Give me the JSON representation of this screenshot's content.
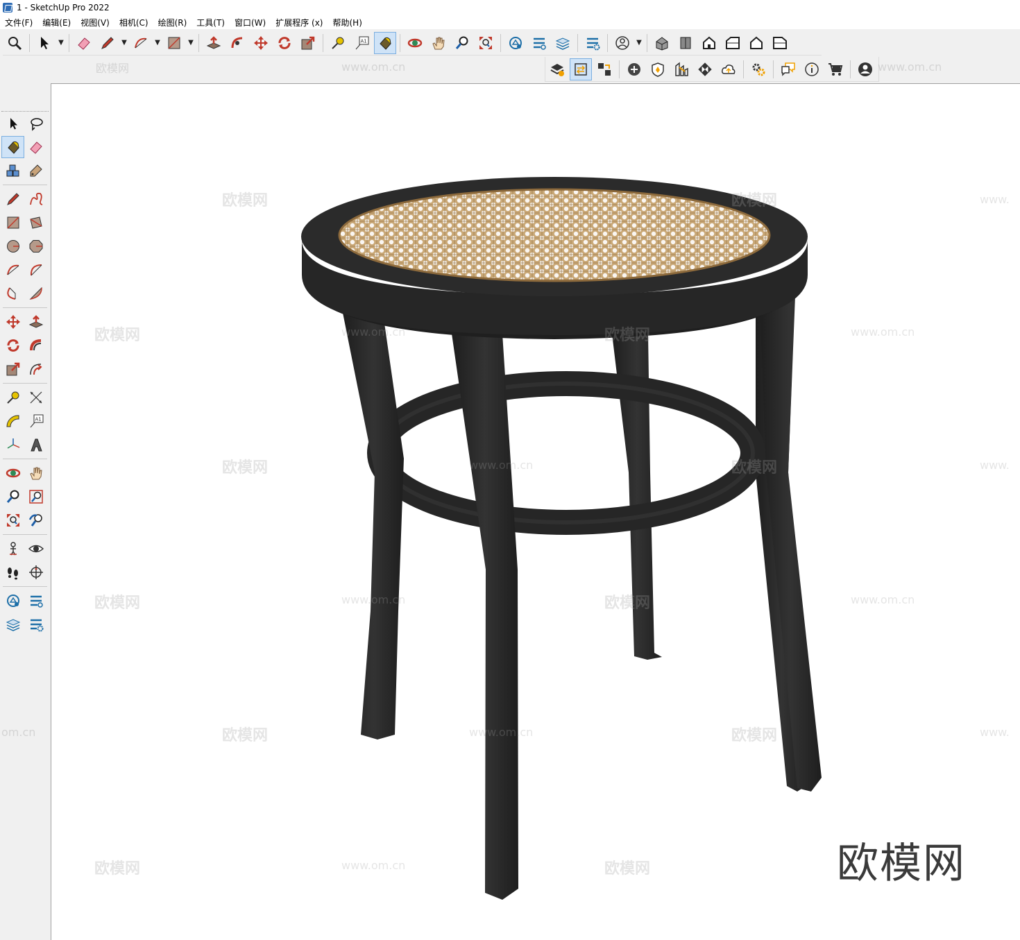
{
  "window": {
    "title": "1 - SketchUp Pro 2022"
  },
  "menu": {
    "items": [
      "文件(F)",
      "编辑(E)",
      "视图(V)",
      "相机(C)",
      "绘图(R)",
      "工具(T)",
      "窗口(W)",
      "扩展程序 (x)",
      "帮助(H)"
    ]
  },
  "watermarks": {
    "brand": "欧模网",
    "url": "www.om.cn",
    "partial_url_left": "om.cn",
    "partial_url_right": "www."
  },
  "viewport": {
    "model": "rattan-seat-stool",
    "colors": {
      "frame": "#2b2b2b",
      "rattan": "#cfae7f",
      "background": "#ffffff"
    }
  }
}
